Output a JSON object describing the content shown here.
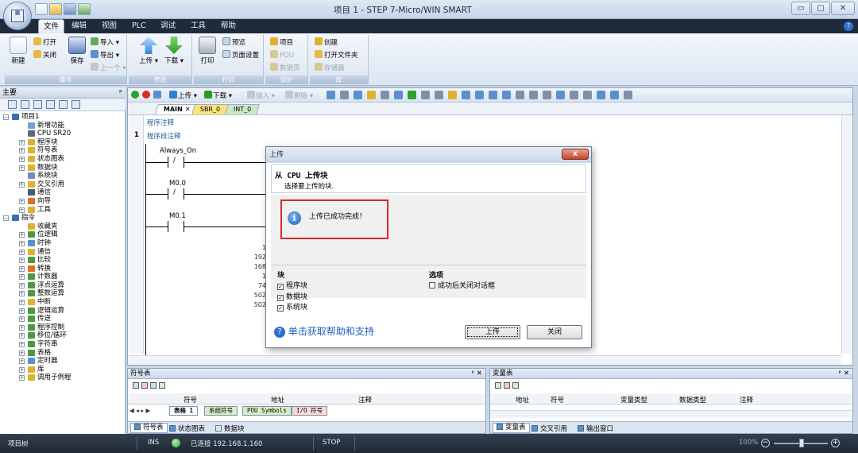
{
  "window": {
    "title": "项目 1 - STEP 7-Micro/WIN SMART",
    "controls": [
      "▭",
      "▢",
      "✕"
    ]
  },
  "menu": {
    "tabs": [
      "文件",
      "编辑",
      "视图",
      "PLC",
      "调试",
      "工具",
      "帮助"
    ],
    "active": "文件"
  },
  "ribbon": {
    "groups": [
      {
        "label": "操作",
        "items": [
          "新建",
          "打开",
          "关闭",
          "保存",
          "导入",
          "导出",
          "上一个"
        ]
      },
      {
        "label": "传送",
        "items": [
          "上传",
          "下载"
        ]
      },
      {
        "label": "打印",
        "items": [
          "打印",
          "预览",
          "页面设置"
        ]
      },
      {
        "label": "保护",
        "items": [
          "项目",
          "POU",
          "数据页"
        ]
      },
      {
        "label": "库",
        "items": [
          "创建",
          "打开文件夹",
          "存储器"
        ]
      }
    ]
  },
  "left_panel": {
    "title": "主要",
    "pin": "ᵖ",
    "tree": [
      {
        "label": "项目1",
        "level": 0,
        "exp": "−",
        "color": "#3a6fb5"
      },
      {
        "label": "新增功能",
        "level": 1,
        "exp": "",
        "color": "#7b9fd0"
      },
      {
        "label": "CPU SR20",
        "level": 1,
        "exp": "",
        "color": "#5b6b7f"
      },
      {
        "label": "程序块",
        "level": 1,
        "exp": "+",
        "color": "#e0b030"
      },
      {
        "label": "符号表",
        "level": 1,
        "exp": "+",
        "color": "#e0b030"
      },
      {
        "label": "状态图表",
        "level": 1,
        "exp": "+",
        "color": "#e0b030"
      },
      {
        "label": "数据块",
        "level": 1,
        "exp": "+",
        "color": "#e0b030"
      },
      {
        "label": "系统块",
        "level": 1,
        "exp": "",
        "color": "#6a8ec0"
      },
      {
        "label": "交叉引用",
        "level": 1,
        "exp": "+",
        "color": "#e0b030"
      },
      {
        "label": "通信",
        "level": 1,
        "exp": "",
        "color": "#4a5a70"
      },
      {
        "label": "向导",
        "level": 1,
        "exp": "+",
        "color": "#e07020"
      },
      {
        "label": "工具",
        "level": 1,
        "exp": "+",
        "color": "#e0b030"
      },
      {
        "label": "指令",
        "level": 0,
        "exp": "−",
        "color": "#3a6fb5"
      },
      {
        "label": "收藏夹",
        "level": 1,
        "exp": "",
        "color": "#e0b030"
      },
      {
        "label": "位逻辑",
        "level": 1,
        "exp": "+",
        "color": "#4a9a40"
      },
      {
        "label": "时钟",
        "level": 1,
        "exp": "+",
        "color": "#5b8fd0"
      },
      {
        "label": "通信",
        "level": 1,
        "exp": "+",
        "color": "#e0b030"
      },
      {
        "label": "比较",
        "level": 1,
        "exp": "+",
        "color": "#4a9a40"
      },
      {
        "label": "转换",
        "level": 1,
        "exp": "+",
        "color": "#e07020"
      },
      {
        "label": "计数器",
        "level": 1,
        "exp": "+",
        "color": "#4a9a40"
      },
      {
        "label": "浮点运算",
        "level": 1,
        "exp": "+",
        "color": "#4a9a40"
      },
      {
        "label": "整数运算",
        "level": 1,
        "exp": "+",
        "color": "#4a9a40"
      },
      {
        "label": "中断",
        "level": 1,
        "exp": "+",
        "color": "#e0b030"
      },
      {
        "label": "逻辑运算",
        "level": 1,
        "exp": "+",
        "color": "#4a9a40"
      },
      {
        "label": "传送",
        "level": 1,
        "exp": "+",
        "color": "#4a9a40"
      },
      {
        "label": "程序控制",
        "level": 1,
        "exp": "+",
        "color": "#4a9a40"
      },
      {
        "label": "移位/循环",
        "level": 1,
        "exp": "+",
        "color": "#4a9a40"
      },
      {
        "label": "字符串",
        "level": 1,
        "exp": "+",
        "color": "#4a9a40"
      },
      {
        "label": "表格",
        "level": 1,
        "exp": "+",
        "color": "#4a9a40"
      },
      {
        "label": "定时器",
        "level": 1,
        "exp": "+",
        "color": "#5b8fd0"
      },
      {
        "label": "库",
        "level": 1,
        "exp": "+",
        "color": "#e0b030"
      },
      {
        "label": "调用子例程",
        "level": 1,
        "exp": "+",
        "color": "#e0b030"
      }
    ]
  },
  "editor": {
    "toolbar": [
      "上传",
      "下载",
      "插入",
      "删除"
    ],
    "tabs": [
      "MAIN",
      "SBR_0",
      "INT_0"
    ],
    "program_comment": "程序注释",
    "network_number": "1",
    "network_comment": "程序段注释",
    "contacts": [
      {
        "label": "Always_On",
        "type": "/"
      },
      {
        "label": "M0.0",
        "type": "/"
      },
      {
        "label": "M0.1",
        "type": ""
      }
    ],
    "partial_values": [
      "1",
      "192",
      "168",
      "1",
      "74",
      "502",
      "502"
    ]
  },
  "dialog": {
    "title": "上传",
    "close": "x",
    "heading": "从 CPU 上传块",
    "subheading": "选择要上传的块.",
    "message": "上传已成功完成！",
    "blocks_label": "块",
    "blocks": [
      {
        "label": "程序块",
        "checked": true
      },
      {
        "label": "数据块",
        "checked": true
      },
      {
        "label": "系统块",
        "checked": true
      }
    ],
    "options_label": "选项",
    "options": [
      {
        "label": "成功后关闭对话框",
        "checked": false
      }
    ],
    "help_link": "单击获取帮助和支持",
    "upload_button": "上传",
    "close_button": "关闭"
  },
  "symbol_table": {
    "title": "符号表",
    "columns": [
      "符号",
      "地址",
      "注释"
    ],
    "sheet_tabs": [
      "表格 1",
      "系统符号",
      "POU Symbols",
      "I/O 符号"
    ],
    "bottom_tabs": [
      "符号表",
      "状态图表",
      "数据块"
    ]
  },
  "variable_table": {
    "title": "变量表",
    "columns": [
      "地址",
      "符号",
      "变量类型",
      "数据类型",
      "注释"
    ],
    "bottom_tabs": [
      "变量表",
      "交叉引用",
      "输出窗口"
    ]
  },
  "status_bar": {
    "left": "项目树",
    "mode": "INS",
    "connection": "已连接 192.168.1.160",
    "state": "STOP",
    "zoom": "100%"
  }
}
